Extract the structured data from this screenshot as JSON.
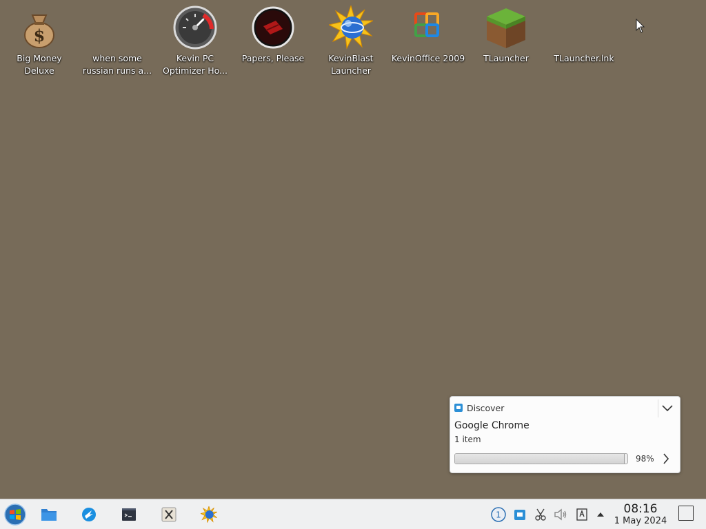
{
  "desktop": {
    "icons": [
      {
        "label": "Big Money Deluxe",
        "icon": "money-bag-icon"
      },
      {
        "label": "when some russian runs a...",
        "icon": "blank-file-icon"
      },
      {
        "label": "Kevin PC Optimizer Ho...",
        "icon": "speedometer-icon"
      },
      {
        "label": "Papers, Please",
        "icon": "papers-please-icon"
      },
      {
        "label": "KevinBlast Launcher",
        "icon": "sun-globe-icon"
      },
      {
        "label": "KevinOffice 2009",
        "icon": "office-logo-icon"
      },
      {
        "label": "TLauncher",
        "icon": "grass-block-icon"
      },
      {
        "label": "TLauncher.lnk",
        "icon": "blank-file-icon"
      }
    ]
  },
  "notification": {
    "app_name": "Discover",
    "title": "Google Chrome",
    "subtitle": "1 item",
    "progress": 98,
    "progress_label": "98%"
  },
  "taskbar": {
    "items": [
      {
        "name": "start-menu-icon"
      },
      {
        "name": "file-manager-icon"
      },
      {
        "name": "web-browser-icon"
      },
      {
        "name": "terminal-icon"
      },
      {
        "name": "x-app-icon"
      },
      {
        "name": "kevinblast-icon"
      }
    ],
    "tray": [
      {
        "name": "updates-badge-icon",
        "text": "1"
      },
      {
        "name": "discover-tray-icon"
      },
      {
        "name": "scissors-icon"
      },
      {
        "name": "volume-muted-icon"
      },
      {
        "name": "keyboard-layout-icon"
      },
      {
        "name": "expand-tray-icon"
      }
    ],
    "clock": {
      "time": "08:16",
      "date": "1 May 2024"
    }
  }
}
